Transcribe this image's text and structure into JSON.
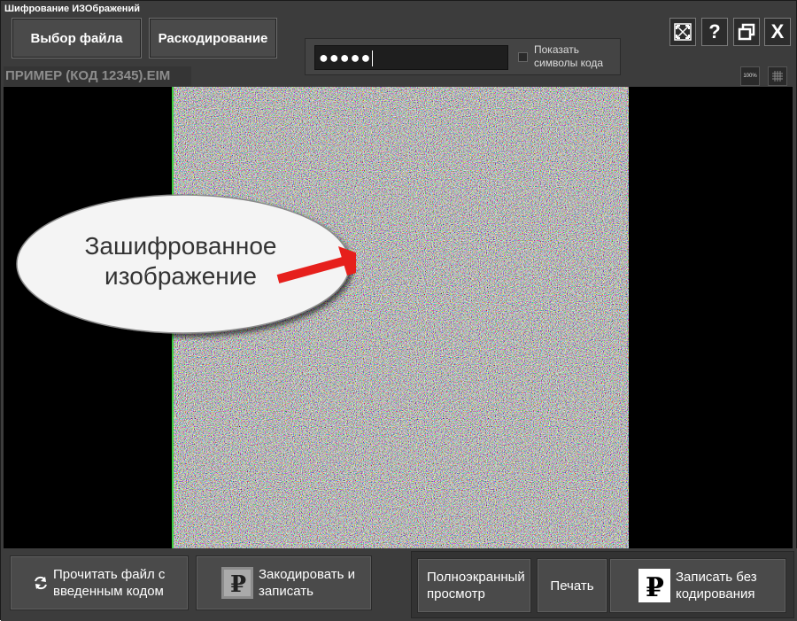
{
  "window": {
    "title": "Шифрование ИЗОбражений"
  },
  "toolbar": {
    "select_file_label": "Выбор файла",
    "decode_label": "Раскодирование"
  },
  "password": {
    "value": "●●●●●",
    "show_symbols_label": "Показать символы кода",
    "show_symbols_checked": false
  },
  "window_buttons": {
    "fit_icon": "fit-screen-icon",
    "help_label": "?",
    "restore_icon": "restore-window-icon",
    "close_label": "X"
  },
  "viewer": {
    "filename": "ПРИМЕР  (КОД 12345).EIM",
    "zoom_100_label": "100%",
    "fit_icon": "grid-icon",
    "annotation": "Зашифрованное изображение"
  },
  "actions": {
    "read_file_label": "Прочитать файл с введенным кодом",
    "encode_save_label": "Закодировать и записать",
    "fullscreen_label": "Полноэкранный просмотр",
    "print_label": "Печать",
    "save_no_encode_label": "Записать без кодирования"
  },
  "colors": {
    "panel": "#3c3c3c",
    "button": "#4a4a4a",
    "arrow": "#e6201c",
    "image_border": "#3ecb3e"
  }
}
